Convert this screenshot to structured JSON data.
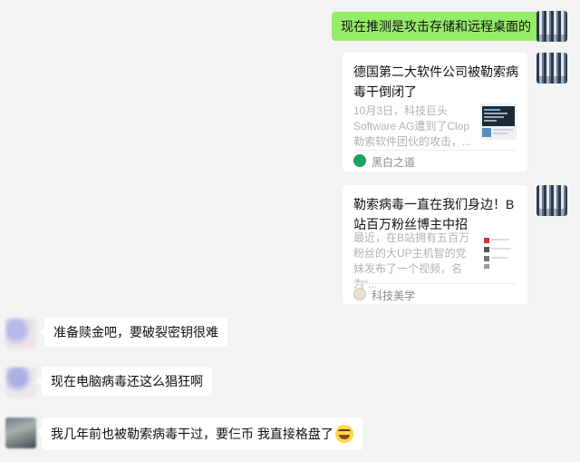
{
  "messages": [
    {
      "side": "right",
      "text": "现在推测是攻击存储和远程桌面的"
    },
    {
      "side": "right",
      "type": "link-card",
      "title": "德国第二大软件公司被勒索病毒干倒闭了",
      "description": "10月3日，科技巨头Software AG遭到了Clop勒索软件团伙的攻击，...",
      "source": "黑白之道",
      "thumb_icon": "screenshot-thumbnail"
    },
    {
      "side": "right",
      "type": "link-card",
      "title": "勒索病毒一直在我们身边！B站百万粉丝博主中招",
      "description": "最近，在B站拥有五百万粉丝的大UP主机智的党妹发布了一个视频，名为“...",
      "source": "科技美学",
      "thumb_icon": "video-thumbnail"
    },
    {
      "side": "left",
      "text": "准备赎金吧，要破裂密钥很难"
    },
    {
      "side": "left",
      "text": "现在电脑病毒还这么猖狂啊"
    },
    {
      "side": "left",
      "text": "我几年前也被勒索病毒干过，要仨币 我直接格盘了",
      "emoji": "smiling-emoji"
    }
  ],
  "colors": {
    "background": "#f3f3f3",
    "self_bubble": "#95ec69",
    "other_bubble": "#ffffff"
  }
}
